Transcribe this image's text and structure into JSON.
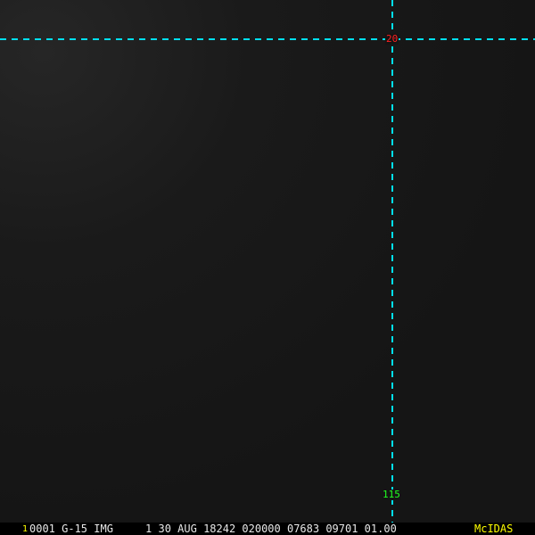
{
  "overlay": {
    "latitude_label": "20",
    "longitude_label": "115",
    "latitude_color": "#ff2020",
    "longitude_color": "#20ff20",
    "grid_color": "#00e0f0"
  },
  "status_bar": {
    "frame_number": "1",
    "text": "0001 G-15 IMG     1 30 AUG 18242 020000 07683 09701 01.00",
    "brand": "McIDAS",
    "frame_color": "#ffff00",
    "brand_color": "#ffff00"
  }
}
